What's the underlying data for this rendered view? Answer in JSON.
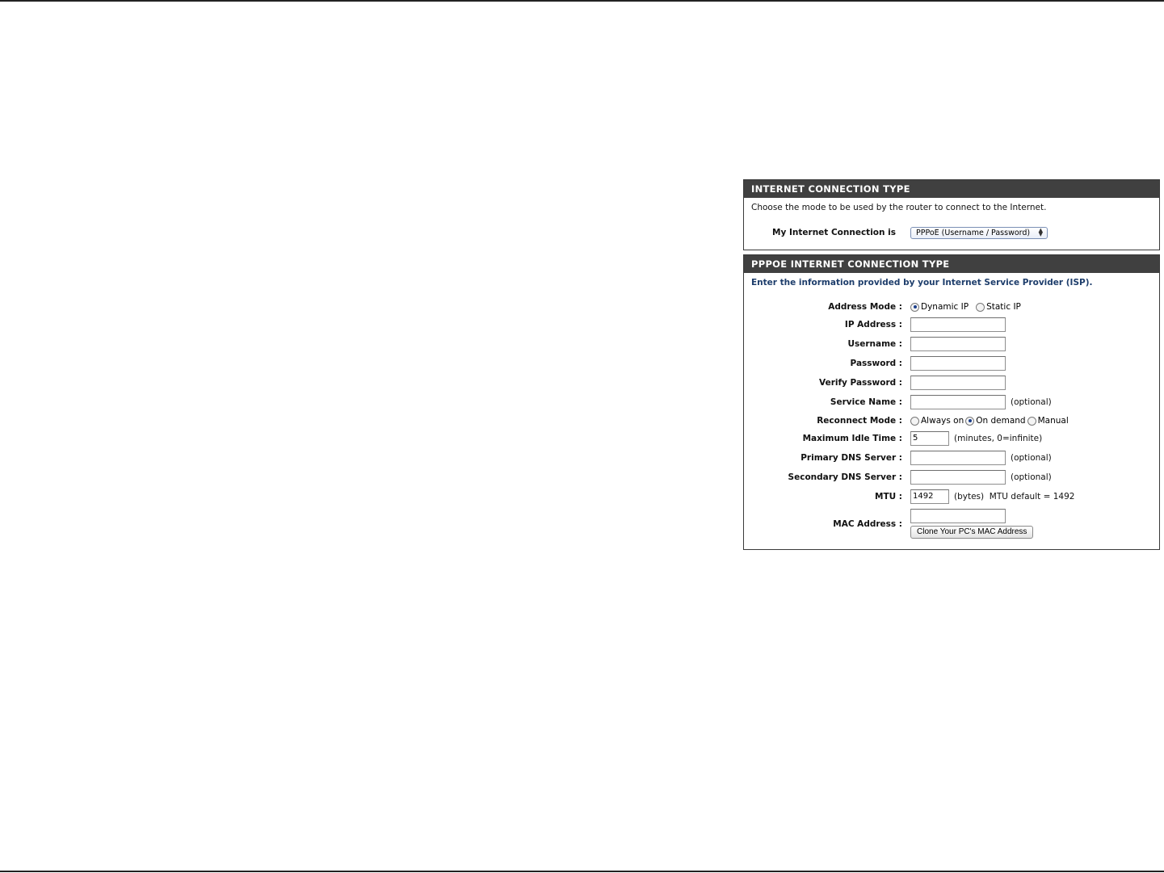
{
  "section1": {
    "title": "INTERNET CONNECTION TYPE",
    "description": "Choose the mode to be used by the router to connect to the Internet.",
    "connection_label": "My Internet Connection is",
    "connection_value": "PPPoE (Username / Password)"
  },
  "section2": {
    "title": "PPPOE INTERNET CONNECTION TYPE",
    "description": "Enter the information provided by your Internet Service Provider (ISP).",
    "address_mode": {
      "label": "Address Mode :",
      "options": [
        "Dynamic IP",
        "Static IP"
      ],
      "selected": "Dynamic IP"
    },
    "ip_address": {
      "label": "IP Address :",
      "value": ""
    },
    "username": {
      "label": "Username :",
      "value": ""
    },
    "password": {
      "label": "Password :",
      "value": ""
    },
    "verify_password": {
      "label": "Verify Password :",
      "value": ""
    },
    "service_name": {
      "label": "Service Name :",
      "value": "",
      "note": "(optional)"
    },
    "reconnect_mode": {
      "label": "Reconnect Mode :",
      "options": [
        "Always on",
        "On demand",
        "Manual"
      ],
      "selected": "On demand"
    },
    "max_idle_time": {
      "label": "Maximum Idle Time :",
      "value": "5",
      "note": "(minutes, 0=infinite)"
    },
    "primary_dns": {
      "label": "Primary DNS Server :",
      "value": "",
      "note": "(optional)"
    },
    "secondary_dns": {
      "label": "Secondary DNS Server :",
      "value": "",
      "note": "(optional)"
    },
    "mtu": {
      "label": "MTU :",
      "value": "1492",
      "note": "(bytes)  MTU default = 1492"
    },
    "mac_address": {
      "label": "MAC Address :",
      "value": "",
      "clone_button": "Clone Your PC's MAC Address"
    }
  }
}
